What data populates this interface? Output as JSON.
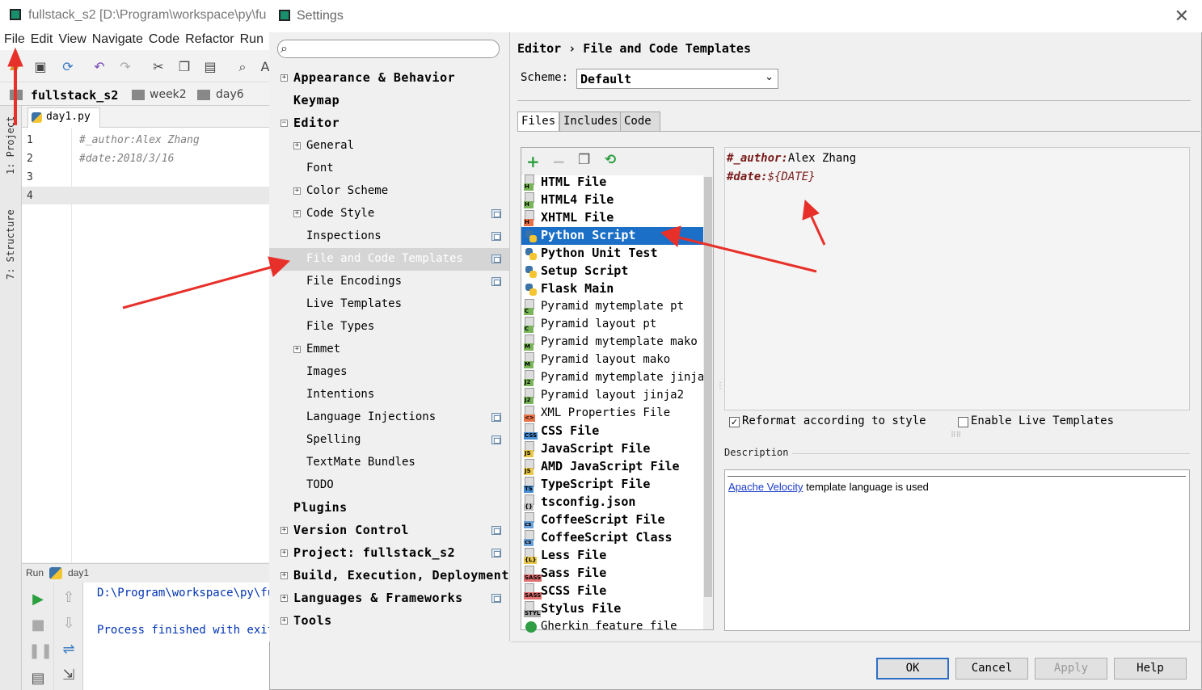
{
  "ide": {
    "title": "fullstack_s2 [D:\\Program\\workspace\\py\\fu",
    "menu": [
      "File",
      "Edit",
      "View",
      "Navigate",
      "Code",
      "Refactor",
      "Run"
    ],
    "breadcrumbs": [
      "fullstack_s2",
      "week2",
      "day6"
    ],
    "side_tools": [
      "1: Project",
      "7: Structure"
    ],
    "tab": "day1.py",
    "line_numbers": [
      "1",
      "2",
      "3",
      "4"
    ],
    "code_lines": [
      "#_author:Alex Zhang",
      "#date:2018/3/16"
    ],
    "run_label": "Run",
    "run_config": "day1",
    "run_output": [
      "D:\\Program\\workspace\\py\\fu",
      "Process finished with exit"
    ]
  },
  "dialog": {
    "title": "Settings",
    "close_glyph": "✕",
    "search_placeholder": "",
    "tree": [
      {
        "label": "Appearance & Behavior",
        "level": 0,
        "expandable": true,
        "bold": true
      },
      {
        "label": "Keymap",
        "level": 0,
        "expandable": false,
        "bold": true
      },
      {
        "label": "Editor",
        "level": 0,
        "expandable": true,
        "expanded": true,
        "bold": true
      },
      {
        "label": "General",
        "level": 1,
        "expandable": true
      },
      {
        "label": "Font",
        "level": 1,
        "expandable": false
      },
      {
        "label": "Color Scheme",
        "level": 1,
        "expandable": true
      },
      {
        "label": "Code Style",
        "level": 1,
        "expandable": true,
        "project": true
      },
      {
        "label": "Inspections",
        "level": 1,
        "expandable": false,
        "project": true
      },
      {
        "label": "File and Code Templates",
        "level": 1,
        "expandable": false,
        "project": true,
        "selected": true
      },
      {
        "label": "File Encodings",
        "level": 1,
        "expandable": false,
        "project": true
      },
      {
        "label": "Live Templates",
        "level": 1,
        "expandable": false
      },
      {
        "label": "File Types",
        "level": 1,
        "expandable": false
      },
      {
        "label": "Emmet",
        "level": 1,
        "expandable": true
      },
      {
        "label": "Images",
        "level": 1,
        "expandable": false
      },
      {
        "label": "Intentions",
        "level": 1,
        "expandable": false
      },
      {
        "label": "Language Injections",
        "level": 1,
        "expandable": false,
        "project": true
      },
      {
        "label": "Spelling",
        "level": 1,
        "expandable": false,
        "project": true
      },
      {
        "label": "TextMate Bundles",
        "level": 1,
        "expandable": false
      },
      {
        "label": "TODO",
        "level": 1,
        "expandable": false
      },
      {
        "label": "Plugins",
        "level": 0,
        "expandable": false,
        "bold": true
      },
      {
        "label": "Version Control",
        "level": 0,
        "expandable": true,
        "bold": true,
        "project": true
      },
      {
        "label": "Project: fullstack_s2",
        "level": 0,
        "expandable": true,
        "bold": true,
        "project": true
      },
      {
        "label": "Build, Execution, Deployment",
        "level": 0,
        "expandable": true,
        "bold": true
      },
      {
        "label": "Languages & Frameworks",
        "level": 0,
        "expandable": true,
        "bold": true,
        "project": true
      },
      {
        "label": "Tools",
        "level": 0,
        "expandable": true,
        "bold": true
      }
    ],
    "breadcrumb": "Editor › File and Code Templates",
    "scheme_label": "Scheme:",
    "scheme_value": "Default",
    "tabs": [
      "Files",
      "Includes",
      "Code"
    ],
    "active_tab": "Files",
    "templates": [
      {
        "name": "HTML File",
        "tag": "H",
        "color": "#7ab55c",
        "bold": true
      },
      {
        "name": "HTML4 File",
        "tag": "H",
        "color": "#7ab55c",
        "bold": true
      },
      {
        "name": "XHTML File",
        "tag": "H",
        "color": "#e8734a",
        "bold": true
      },
      {
        "name": "Python Script",
        "tag": "py",
        "color": "",
        "bold": true,
        "selected": true
      },
      {
        "name": "Python Unit Test",
        "tag": "py",
        "color": "",
        "bold": true
      },
      {
        "name": "Setup Script",
        "tag": "py",
        "color": "",
        "bold": true
      },
      {
        "name": "Flask Main",
        "tag": "py",
        "color": "",
        "bold": true
      },
      {
        "name": "Pyramid mytemplate pt",
        "tag": "C",
        "color": "#7ab55c",
        "bold": false
      },
      {
        "name": "Pyramid layout pt",
        "tag": "C",
        "color": "#7ab55c",
        "bold": false
      },
      {
        "name": "Pyramid mytemplate mako",
        "tag": "M",
        "color": "#7ab55c",
        "bold": false
      },
      {
        "name": "Pyramid layout mako",
        "tag": "M",
        "color": "#7ab55c",
        "bold": false
      },
      {
        "name": "Pyramid mytemplate jinja2",
        "tag": "J2",
        "color": "#7ab55c",
        "bold": false
      },
      {
        "name": "Pyramid layout jinja2",
        "tag": "J2",
        "color": "#7ab55c",
        "bold": false
      },
      {
        "name": "XML Properties File",
        "tag": "<>",
        "color": "#e8734a",
        "bold": false
      },
      {
        "name": "CSS File",
        "tag": "CSS",
        "color": "#4a8fd4",
        "bold": true
      },
      {
        "name": "JavaScript File",
        "tag": "JS",
        "color": "#e8c84a",
        "bold": true
      },
      {
        "name": "AMD JavaScript File",
        "tag": "JS",
        "color": "#e8c84a",
        "bold": true
      },
      {
        "name": "TypeScript File",
        "tag": "TS",
        "color": "#4a8fd4",
        "bold": true
      },
      {
        "name": "tsconfig.json",
        "tag": "{}",
        "color": "#bbbbbb",
        "bold": true
      },
      {
        "name": "CoffeeScript File",
        "tag": "cs",
        "color": "#6aa0d8",
        "bold": true
      },
      {
        "name": "CoffeeScript Class",
        "tag": "cs",
        "color": "#6aa0d8",
        "bold": true
      },
      {
        "name": "Less File",
        "tag": "{L}",
        "color": "#e8c84a",
        "bold": true
      },
      {
        "name": "Sass File",
        "tag": "SASS",
        "color": "#e07070",
        "bold": true
      },
      {
        "name": "SCSS File",
        "tag": "SASS",
        "color": "#e07070",
        "bold": true
      },
      {
        "name": "Stylus File",
        "tag": "STYL",
        "color": "#aaaaaa",
        "bold": true
      },
      {
        "name": "Gherkin feature file",
        "tag": "gh",
        "color": "#2f9e44",
        "bold": false
      }
    ],
    "template_body": {
      "line1_key": "#_author:",
      "line1_val": "Alex Zhang",
      "line2_key": "#date:",
      "line2_val": "${DATE}"
    },
    "reformat_label": "Reformat according to style",
    "reformat_checked": true,
    "live_templates_label": "Enable Live Templates",
    "live_templates_checked": false,
    "description_label": "Description",
    "description_link": "Apache Velocity",
    "description_text": " template language is used",
    "buttons": {
      "ok": "OK",
      "cancel": "Cancel",
      "apply": "Apply",
      "help": "Help"
    }
  },
  "colors": {
    "selection": "#1b6fc7",
    "tree_selection": "#d5d5d5",
    "annotation_arrow": "#e8302a",
    "template_keyword": "#7a1a1a"
  }
}
